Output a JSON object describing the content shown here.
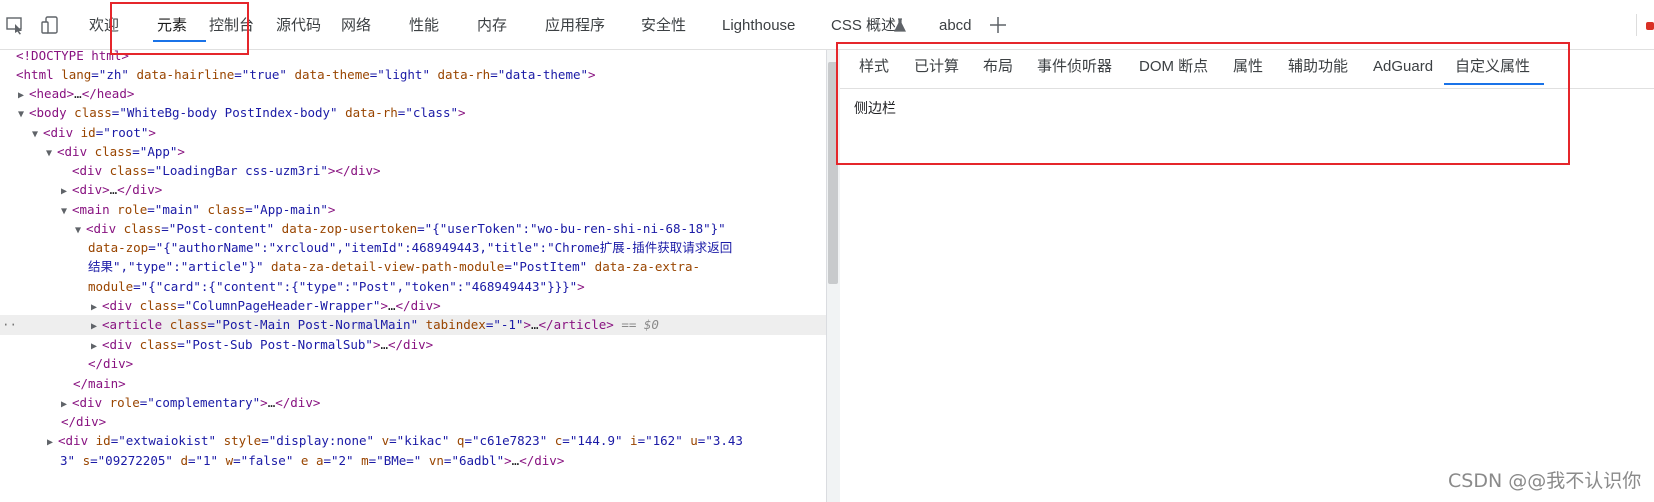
{
  "toolbar": {
    "tabs": [
      "欢迎",
      "元素",
      "控制台",
      "源代码",
      "网络",
      "性能",
      "内存",
      "应用程序",
      "安全性",
      "Lighthouse",
      "CSS 概述",
      "abcd"
    ],
    "active_tab": "元素",
    "flask_icon": "flask-icon",
    "add_icon": "plus-icon"
  },
  "dom": {
    "lines": {
      "l1": {
        "t1": "<!DOCTYPE html>"
      },
      "l2": {
        "t1": "<html",
        "a1": " lang",
        "v1": "=\"zh\"",
        "a2": " data-hairline",
        "v2": "=\"true\"",
        "a3": " data-theme",
        "v3": "=\"light\"",
        "a4": " data-rh",
        "v4": "=\"data-theme\"",
        "t2": ">"
      },
      "l3": {
        "t1": "<head>",
        "x": "…",
        "t2": "</head>"
      },
      "l4": {
        "t1": "<body",
        "a1": " class",
        "v1": "=\"WhiteBg-body PostIndex-body\"",
        "a2": " data-rh",
        "v2": "=\"class\"",
        "t2": ">"
      },
      "l5": {
        "t1": "<div",
        "a1": " id",
        "v1": "=\"root\"",
        "t2": ">"
      },
      "l6": {
        "t1": "<div",
        "a1": " class",
        "v1": "=\"App\"",
        "t2": ">"
      },
      "l7": {
        "t1": "<div",
        "a1": " class",
        "v1": "=\"LoadingBar  css-uzm3ri\"",
        "t2": "></div>"
      },
      "l8": {
        "t1": "<div>",
        "x": "…",
        "t2": "</div>"
      },
      "l9": {
        "t1": "<main",
        "a1": " role",
        "v1": "=\"main\"",
        "a2": " class",
        "v2": "=\"App-main\"",
        "t2": ">"
      },
      "l10": {
        "t1": "<div",
        "a1": " class",
        "v1": "=\"Post-content\"",
        "a2": " data-zop-usertoken",
        "v2": "=\"{\"userToken\":\"wo-bu-ren-shi-ni-68-18\"}\""
      },
      "l11": {
        "a1": "data-zop",
        "v1": "=\"{\"authorName\":\"xrcloud\",\"itemId\":468949443,\"title\":\"Chrome扩展-插件获取请求返回"
      },
      "l12": {
        "v1": "结果\",\"type\":\"article\"}\"",
        "a1": " data-za-detail-view-path-module",
        "v2": "=\"PostItem\"",
        "a2": " data-za-extra-"
      },
      "l13": {
        "a1": "module",
        "v1": "=\"{\"card\":{\"content\":{\"type\":\"Post\",\"token\":\"468949443\"}}}\"",
        "t1": ">"
      },
      "l14": {
        "t1": "<div",
        "a1": " class",
        "v1": "=\"ColumnPageHeader-Wrapper\"",
        "t2": ">",
        "x": "…",
        "t3": "</div>"
      },
      "l15": {
        "dots": "··",
        "t1": "<article",
        "a1": " class",
        "v1": "=\"Post-Main Post-NormalMain\"",
        "a2": " tabindex",
        "v2": "=\"-1\"",
        "t2": ">",
        "x": "…",
        "t3": "</article>",
        "d": " == $0"
      },
      "l16": {
        "t1": "<div",
        "a1": " class",
        "v1": "=\"Post-Sub Post-NormalSub\"",
        "t2": ">",
        "x": "…",
        "t3": "</div>"
      },
      "l17": {
        "t1": "</div>"
      },
      "l18": {
        "t1": "</main>"
      },
      "l19": {
        "t1": "<div",
        "a1": " role",
        "v1": "=\"complementary\"",
        "t2": ">",
        "x": "…",
        "t3": "</div>"
      },
      "l20": {
        "t1": "</div>"
      },
      "l21": {
        "t1": "<div",
        "a1": " id",
        "v1": "=\"extwaiokist\"",
        "a2": " style",
        "v2": "=\"display:none\"",
        "a3": " v",
        "v3": "=\"kikac\"",
        "a4": " q",
        "v4": "=\"c61e7823\"",
        "a5": " c",
        "v5": "=\"144.9\"",
        "a6": " i",
        "v6": "=\"162\"",
        "a7": " u",
        "v7": "=\"3.43"
      },
      "l22": {
        "v0": "3\"",
        "a1": " s",
        "v1": "=\"09272205\"",
        "a2": " d",
        "v2": "=\"1\"",
        "a3": " w",
        "v3": "=\"false\"",
        "a4": " e a",
        "v4": "=\"2\"",
        "a5": " m",
        "v5": "=\"BMe=\"",
        "a6": " vn",
        "v6": "=\"6adbl\"",
        "t1": ">",
        "x": "…",
        "t2": "</div>"
      }
    }
  },
  "side": {
    "tabs": [
      "样式",
      "已计算",
      "布局",
      "事件侦听器",
      "DOM 断点",
      "属性",
      "辅助功能",
      "AdGuard",
      "自定义属性"
    ],
    "active_tab": "自定义属性",
    "content": "侧边栏"
  },
  "watermark": "CSDN @@我不认识你",
  "colors": {
    "annotation": "#e5262b",
    "accent": "#1a73e8",
    "tag": "#881280",
    "attr": "#994500",
    "value": "#1a1aa6"
  }
}
